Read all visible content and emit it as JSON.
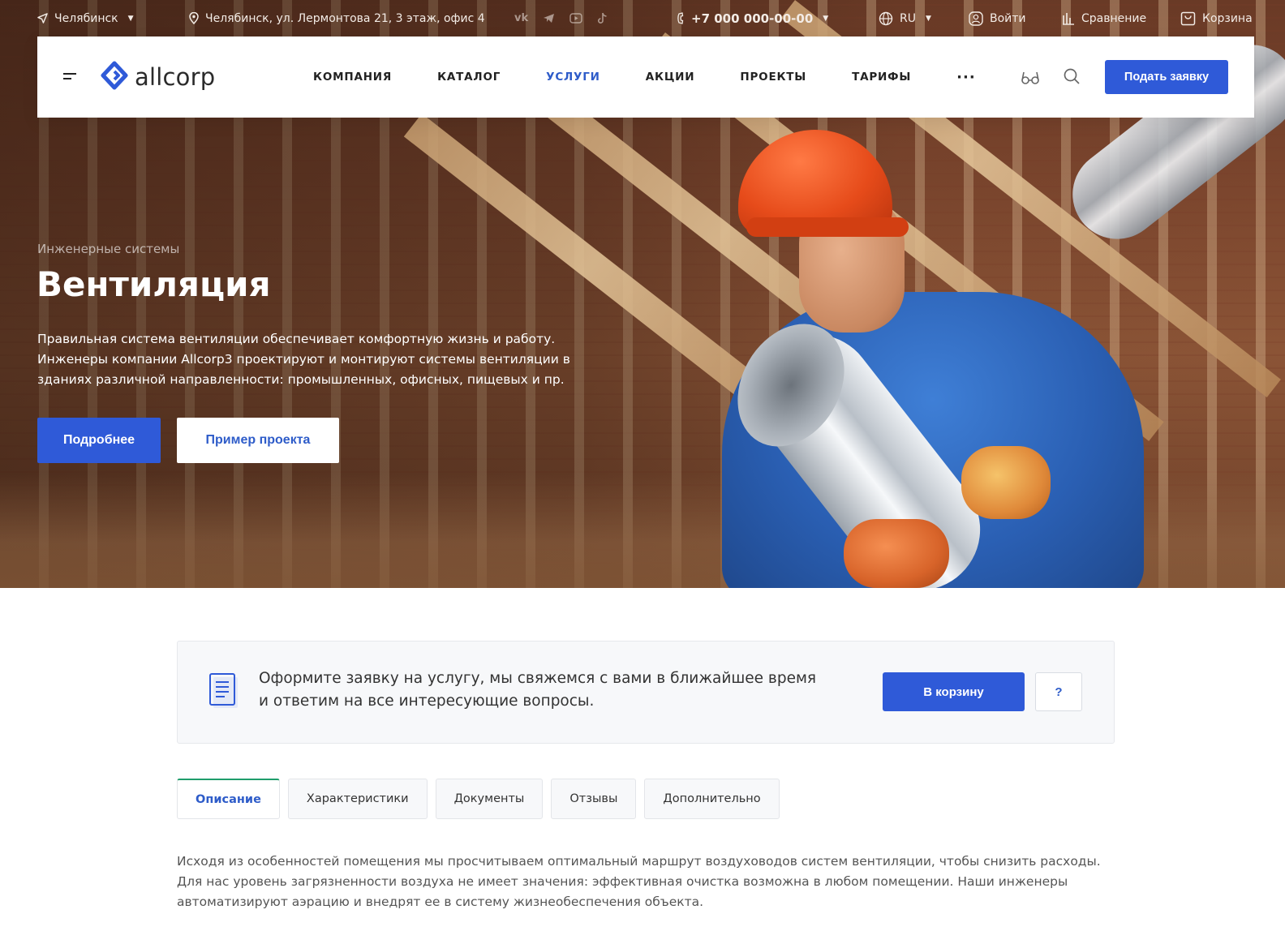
{
  "topbar": {
    "city": "Челябинск",
    "address": "Челябинск, ул. Лермонтова 21, 3 этаж, офис 4",
    "social": [
      "vk-icon",
      "telegram-icon",
      "youtube-icon",
      "tiktok-icon"
    ],
    "phone": "+7 000 000-00-00",
    "language": "RU",
    "login": "Войти",
    "compare": "Сравнение",
    "cart": "Корзина"
  },
  "header": {
    "logo_text": "allcorp",
    "nav": [
      {
        "label": "КОМПАНИЯ",
        "active": false
      },
      {
        "label": "КАТАЛОГ",
        "active": false
      },
      {
        "label": "УСЛУГИ",
        "active": true
      },
      {
        "label": "АКЦИИ",
        "active": false
      },
      {
        "label": "ПРОЕКТЫ",
        "active": false
      },
      {
        "label": "ТАРИФЫ",
        "active": false
      }
    ],
    "more": "···",
    "cta": "Подать заявку"
  },
  "hero": {
    "subtitle": "Инженерные системы",
    "title": "Вентиляция",
    "text": "Правильная система вентиляции обеспечивает комфортную жизнь и работу. Инженеры компании Allcorp3 проектируют и монтируют системы вентиляции в зданиях различной направленности: промышленных, офисных, пищевых и пр.",
    "btn_more": "Подробнее",
    "btn_example": "Пример проекта"
  },
  "order": {
    "text": "Оформите заявку на услугу, мы свяжемся с вами в ближайшее время и ответим на все интересующие вопросы.",
    "btn_cart": "В корзину",
    "btn_question": "?"
  },
  "tabs": [
    {
      "label": "Описание",
      "active": true
    },
    {
      "label": "Характеристики",
      "active": false
    },
    {
      "label": "Документы",
      "active": false
    },
    {
      "label": "Отзывы",
      "active": false
    },
    {
      "label": "Дополнительно",
      "active": false
    }
  ],
  "description": "Исходя из особенностей помещения мы просчитываем оптимальный маршрут воздуховодов систем вентиляции, чтобы снизить расходы. Для нас уровень загрязненности воздуха не имеет значения: эффективная очистка возможна в любом помещении. Наши инженеры автоматизируют аэрацию и внедрят ее в систему жизнеобеспечения объекта.",
  "colors": {
    "accent": "#2f5ad8",
    "active_nav": "#2e5cc9",
    "tab_indicator": "#1f9d6b"
  }
}
